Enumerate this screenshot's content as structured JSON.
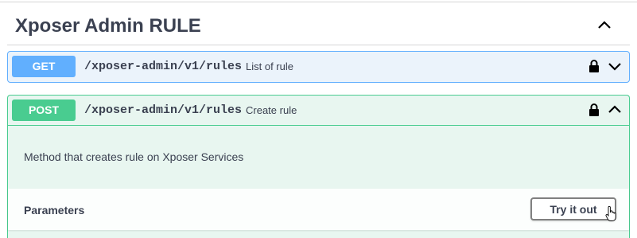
{
  "section": {
    "title": "Xposer Admin RULE"
  },
  "operations": [
    {
      "method": "GET",
      "path": "/xposer-admin/v1/rules",
      "summary": "List of rule",
      "expanded": false
    },
    {
      "method": "POST",
      "path": "/xposer-admin/v1/rules",
      "summary": "Create rule",
      "expanded": true,
      "description": "Method that creates rule on Xposer Services",
      "parameters_title": "Parameters",
      "try_button": "Try it out"
    }
  ],
  "colors": {
    "get": "#61affe",
    "post": "#49cc90",
    "text": "#3b4151"
  },
  "icons": {
    "collapse": "chevron-up-icon",
    "lock": "lock-icon",
    "expand": "chevron-down-icon",
    "cursor": "hand-cursor-icon"
  }
}
